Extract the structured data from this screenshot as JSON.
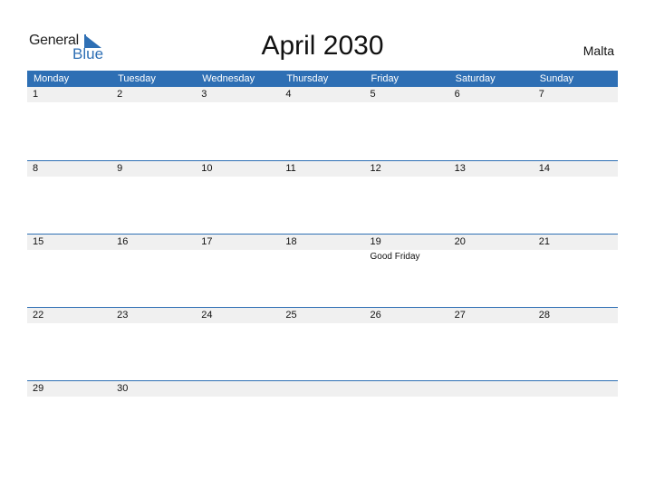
{
  "logo": {
    "general": "General",
    "blue": "Blue"
  },
  "title": "April 2030",
  "country": "Malta",
  "weekdays": [
    "Monday",
    "Tuesday",
    "Wednesday",
    "Thursday",
    "Friday",
    "Saturday",
    "Sunday"
  ],
  "weeks": [
    {
      "days": [
        "1",
        "2",
        "3",
        "4",
        "5",
        "6",
        "7"
      ],
      "events": [
        "",
        "",
        "",
        "",
        "",
        "",
        ""
      ]
    },
    {
      "days": [
        "8",
        "9",
        "10",
        "11",
        "12",
        "13",
        "14"
      ],
      "events": [
        "",
        "",
        "",
        "",
        "",
        "",
        ""
      ]
    },
    {
      "days": [
        "15",
        "16",
        "17",
        "18",
        "19",
        "20",
        "21"
      ],
      "events": [
        "",
        "",
        "",
        "",
        "Good Friday",
        "",
        ""
      ]
    },
    {
      "days": [
        "22",
        "23",
        "24",
        "25",
        "26",
        "27",
        "28"
      ],
      "events": [
        "",
        "",
        "",
        "",
        "",
        "",
        ""
      ]
    },
    {
      "days": [
        "29",
        "30",
        "",
        "",
        "",
        "",
        ""
      ],
      "events": [
        "",
        "",
        "",
        "",
        "",
        "",
        ""
      ]
    }
  ],
  "colors": {
    "accent": "#2e6fb4",
    "strip": "#f0f0f0"
  }
}
